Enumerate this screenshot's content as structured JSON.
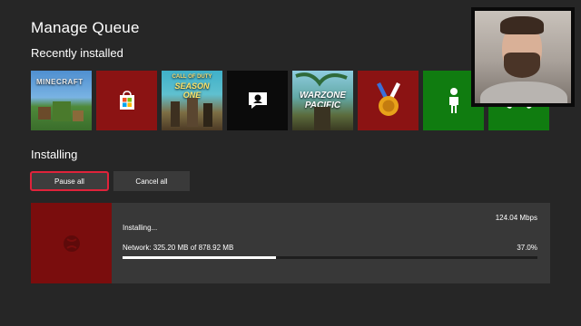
{
  "page": {
    "title": "Manage Queue"
  },
  "recent": {
    "title": "Recently installed",
    "tiles": [
      {
        "icon": "minecraft-art",
        "caption": "MINECRAFT"
      },
      {
        "icon": "store-bag-icon"
      },
      {
        "icon": "cod-art",
        "caption": "CALL OF DUTY",
        "sub": "SEASON ONE"
      },
      {
        "icon": "feedback-icon"
      },
      {
        "icon": "warzone-art",
        "caption": "WARZONE PACIFIC"
      },
      {
        "icon": "medal-icon"
      },
      {
        "icon": "avatar-icon"
      },
      {
        "icon": "controller-icon"
      }
    ]
  },
  "installing": {
    "title": "Installing",
    "pause_label": "Pause all",
    "cancel_label": "Cancel all",
    "item": {
      "status": "Installing...",
      "speed": "124.04 Mbps",
      "network": "Network: 325.20 MB of 878.92 MB",
      "percent": "37.0%",
      "progress": 0.37
    }
  },
  "colors": {
    "accent": "#e0233b",
    "xbox_green": "#107c10",
    "dark_red": "#8b1313"
  }
}
